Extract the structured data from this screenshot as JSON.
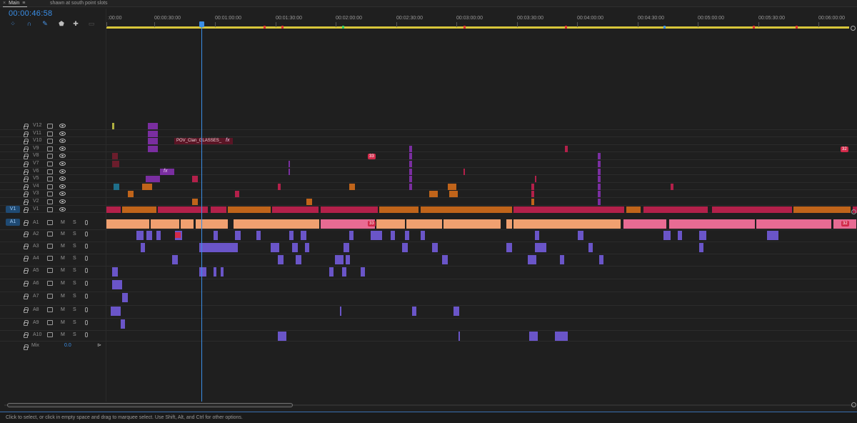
{
  "tabs": {
    "main_close": "×",
    "main_label": "Main",
    "main_menu": "≡",
    "sequence_label": "shawn at south point slots"
  },
  "timecode": "00:00:46:58",
  "tools": [
    {
      "name": "snap-icon",
      "glyph": "⁘"
    },
    {
      "name": "linked-selection-icon",
      "glyph": "∩"
    },
    {
      "name": "add-marker-icon",
      "glyph": "✎"
    },
    {
      "name": "marker-icon",
      "glyph": "⬟"
    },
    {
      "name": "wrench-icon",
      "glyph": "✚"
    },
    {
      "name": "captions-icon",
      "glyph": "▭"
    }
  ],
  "ruler_ticks": [
    ":00:00",
    "00:00:30:00",
    "00:01:00:00",
    "00:01:30:00",
    "00:02:00:00",
    "00:02:30:00",
    "00:03:00:00",
    "00:03:30:00",
    "00:04:00:00",
    "00:04:30:00",
    "00:05:00:00",
    "00:05:30:00",
    "00:06:00:00"
  ],
  "video_tracks": [
    "V12",
    "V11",
    "V10",
    "V9",
    "V8",
    "V7",
    "V6",
    "V5",
    "V4",
    "V3",
    "V2",
    "V1"
  ],
  "audio_tracks": [
    "A1",
    "A2",
    "A3",
    "A4",
    "A5",
    "A6",
    "A7",
    "A8",
    "A9",
    "A10"
  ],
  "source_patch": {
    "video": "V1",
    "audio": "A1"
  },
  "audio_buttons": {
    "mute": "M",
    "solo": "S"
  },
  "mix": {
    "label": "Mix",
    "value": "0.0"
  },
  "clip_label_v10": "POV_Clan_GLASSES_",
  "fx_label": "fx",
  "badges": {
    "v9_mid": "33",
    "v9_end": "32",
    "a1_mid": "33",
    "a1_end": "32"
  },
  "status_text": "Click to select, or click in empty space and drag to marquee select. Use Shift, Alt, and Ctrl for other options.",
  "colors": {
    "accent": "#3a8ee6",
    "video_clip": "#b3204a",
    "video_clip_orange": "#c0641a",
    "audio_clip": "#f0a070",
    "audio_clip_pink": "#e86b93",
    "audio_secondary": "#6a55c8",
    "purple_clip": "#7a2ea0"
  }
}
